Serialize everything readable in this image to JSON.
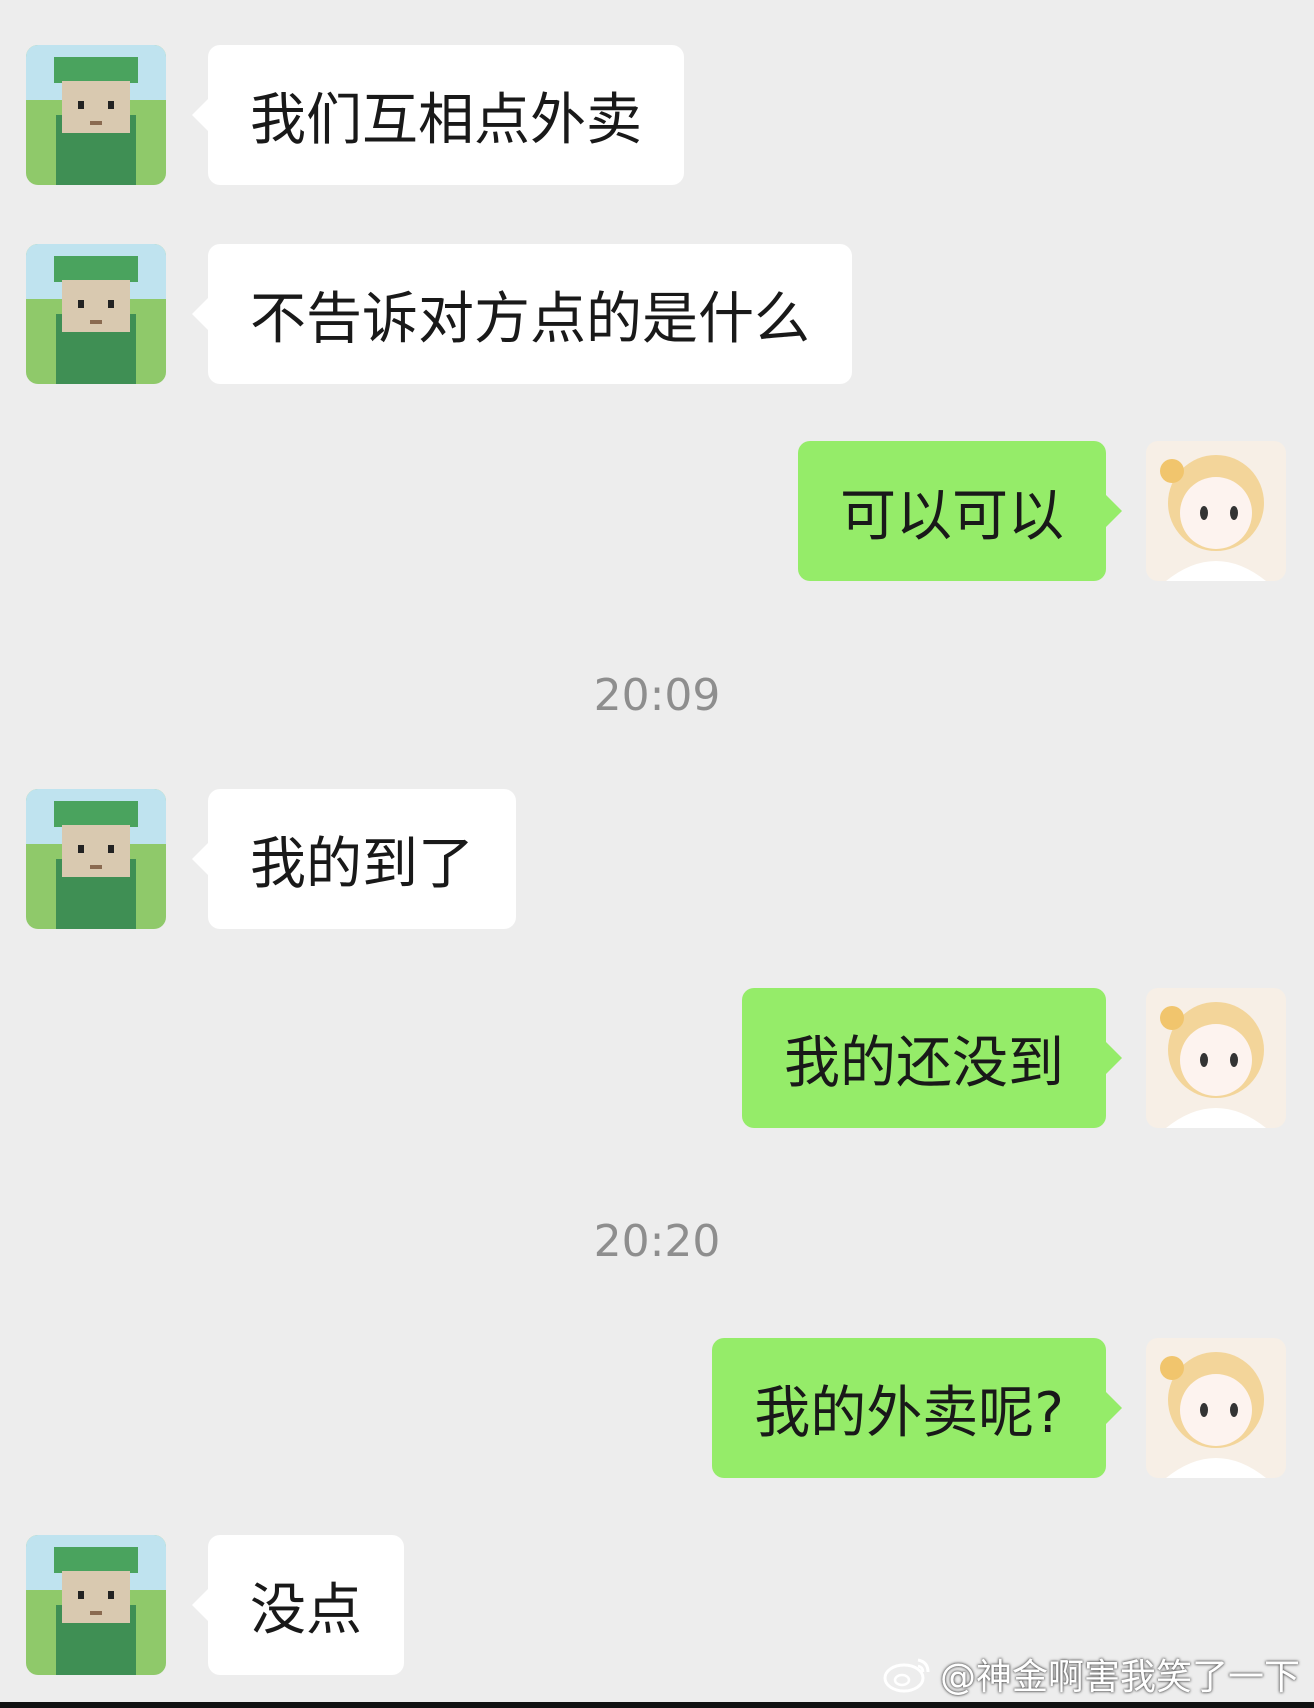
{
  "messages": [
    {
      "side": "in",
      "text": "我们互相点外卖"
    },
    {
      "side": "in",
      "text": "不告诉对方点的是什么"
    },
    {
      "side": "out",
      "text": "可以可以"
    },
    {
      "side": "time",
      "text": "20:09"
    },
    {
      "side": "in",
      "text": "我的到了"
    },
    {
      "side": "out",
      "text": "我的还没到"
    },
    {
      "side": "time",
      "text": "20:20"
    },
    {
      "side": "out",
      "text": "我的外卖呢?"
    },
    {
      "side": "in",
      "text": "没点"
    }
  ],
  "watermark": {
    "handle": "@神金啊害我笑了一下",
    "icon": "weibo-logo-icon"
  },
  "colors": {
    "background": "#ededed",
    "incoming_bubble": "#ffffff",
    "outgoing_bubble": "#95ec69"
  }
}
